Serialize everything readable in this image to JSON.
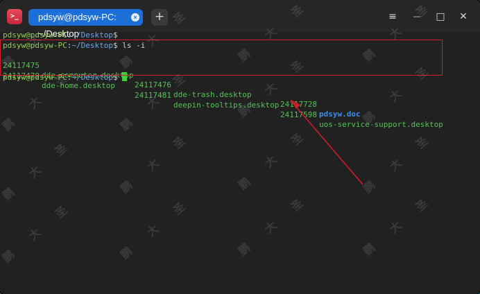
{
  "window": {
    "title_tab": "pdsyw@pdsyw-PC: ~/Desktop",
    "app_icon_glyph": ">_",
    "tab_close_glyph": "×",
    "new_tab_glyph": "+",
    "controls": {
      "menu": "≡",
      "minimize": "—",
      "maximize": "□",
      "close": "✕"
    }
  },
  "terminal": {
    "prompt_user": "pdsyw@pdsyw-PC",
    "prompt_sep": ":",
    "prompt_path": "~/Desktop",
    "prompt_symbol": "$",
    "command": " ls -i",
    "listing": [
      {
        "inode": "24117475",
        "name": "dde-computer.desktop"
      },
      {
        "inode": "24117476",
        "name": "dde-trash.desktop"
      },
      {
        "inode": "24117728",
        "name": "pdsyw.doc"
      },
      {
        "inode": "24117479",
        "name": "dde-home.desktop"
      },
      {
        "inode": "24117481",
        "name": "deepin-tooltips.desktop"
      },
      {
        "inode": "24117598",
        "name": "uos-service-support.desktop"
      }
    ]
  },
  "watermark_text": "鹏 大 圣",
  "colors": {
    "tab": "#1b6fd6",
    "prompt_user": "#8fd14f",
    "prompt_path": "#6ea7e6",
    "listing_green": "#52c452",
    "doc_blue": "#3b8ef0",
    "annotation_red": "#d01c2a"
  },
  "icons": [
    "terminal-app-icon",
    "tab-close-icon",
    "plus-icon",
    "hamburger-menu-icon",
    "minimize-icon",
    "maximize-icon",
    "close-icon"
  ]
}
